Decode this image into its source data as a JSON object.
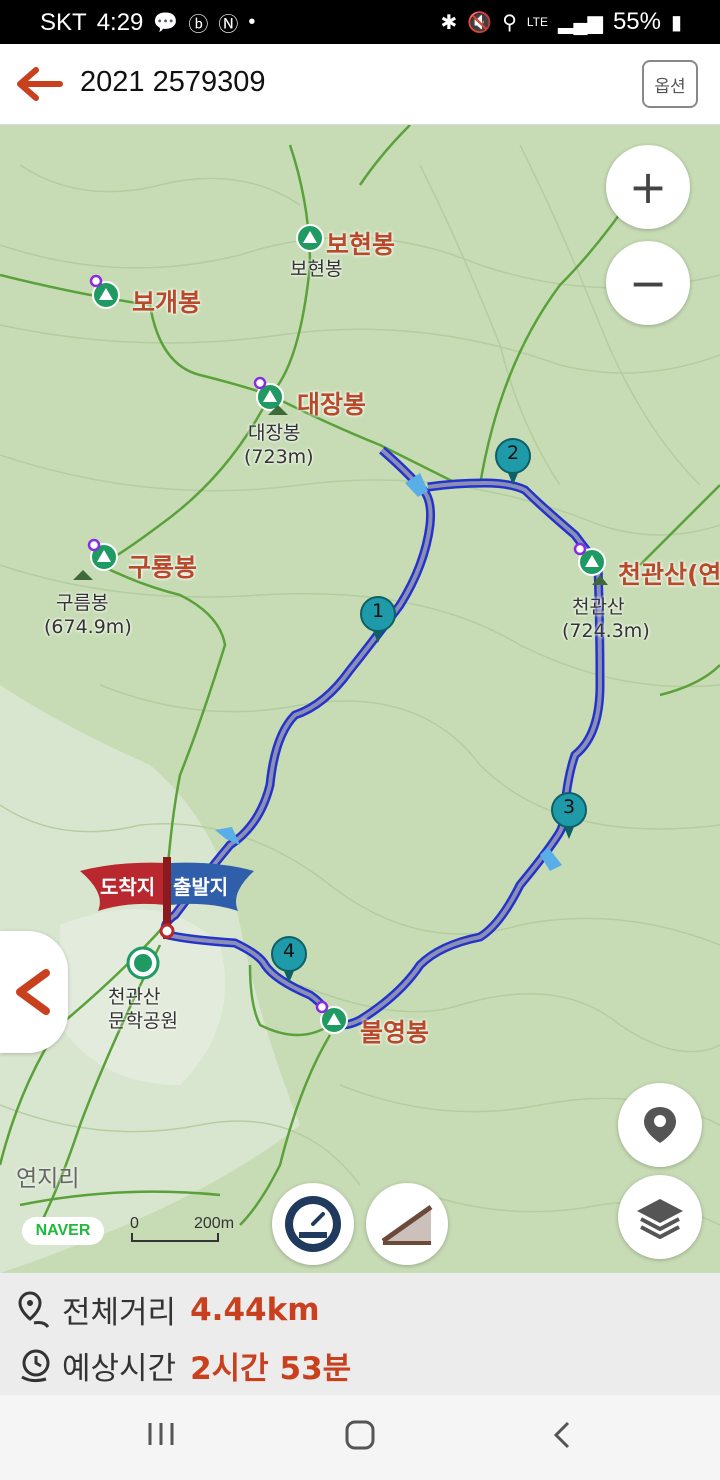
{
  "status": {
    "carrier": "SKT",
    "time": "4:29",
    "battery": "55%",
    "network": "LTE",
    "left_icons": [
      "kakaotalk-icon",
      "band-icon",
      "nfc-icon",
      "dot-icon"
    ],
    "right_icons": [
      "bluetooth-icon",
      "mute-icon",
      "location-icon",
      "signal-icon",
      "battery-icon"
    ]
  },
  "header": {
    "title": "2021 2579309",
    "option_label": "옵션"
  },
  "map": {
    "peaks": [
      {
        "name": "보현봉",
        "sub": "보현봉"
      },
      {
        "name": "보개봉"
      },
      {
        "name": "대장봉",
        "sub": "대장봉",
        "elev": "(723m)"
      },
      {
        "name": "구룡봉",
        "sub": "구름봉",
        "elev": "(674.9m)"
      },
      {
        "name": "천관산(연",
        "sub": "천관산",
        "elev": "(724.3m)"
      },
      {
        "name": "불영봉"
      }
    ],
    "park": {
      "line1": "천관산",
      "line2": "문학공원"
    },
    "village": "연지리",
    "waypoints": [
      "1",
      "2",
      "3",
      "4"
    ],
    "flag": {
      "end": "도착지",
      "start": "출발지"
    },
    "scale": {
      "zero": "0",
      "distance": "200m"
    },
    "logo": "NAVER",
    "route_color": "#2433c9",
    "accent_color": "#c9401e"
  },
  "summary": {
    "distance_label": "전체거리",
    "distance_value": "4.44km",
    "time_label": "예상시간",
    "time_value": "2시간 53분"
  }
}
